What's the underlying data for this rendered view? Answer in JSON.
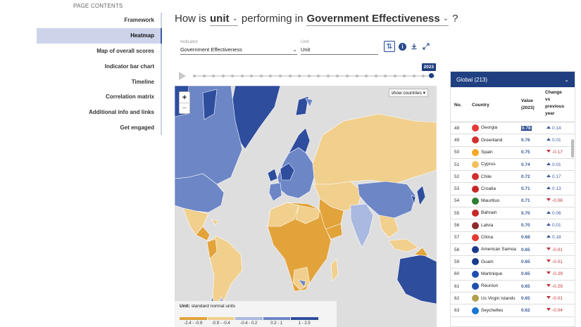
{
  "nav": {
    "heading": "PAGE CONTENTS",
    "items": [
      {
        "label": "Framework",
        "active": false
      },
      {
        "label": "Heatmap",
        "active": true
      },
      {
        "label": "Map of overall scores",
        "active": false
      },
      {
        "label": "Indicator bar chart",
        "active": false
      },
      {
        "label": "Timeline",
        "active": false
      },
      {
        "label": "Correlation matrix",
        "active": false
      },
      {
        "label": "Additional info and links",
        "active": false
      },
      {
        "label": "Get engaged",
        "active": false
      }
    ]
  },
  "question": {
    "prefix": "How is",
    "unit_select": "unit",
    "middle": "performing in",
    "indicator_select": "Government Effectiveness",
    "suffix": "?"
  },
  "filters": {
    "indicator_label": "Indicator",
    "indicator_value": "Government Effectiveness",
    "unit_label": "Unit",
    "unit_value": "Unit"
  },
  "toolbar": {
    "settings_icon": "sliders-icon",
    "info_icon": "info-icon",
    "download_icon": "download-icon",
    "expand_icon": "expand-icon"
  },
  "timeline": {
    "year": "2023"
  },
  "map": {
    "zoom_in": "+",
    "zoom_out": "−",
    "show_countries": "show countries",
    "legend_title": "Unit:",
    "legend_unit": "standard normal units",
    "legend_bins": [
      {
        "label": "-2.4 - -0.9",
        "color": "#e2a33b"
      },
      {
        "label": "-0.9 - -0.4",
        "color": "#f1cf8d"
      },
      {
        "label": "-0.4 - 0.2",
        "color": "#a9b9df"
      },
      {
        "label": "0.2 - 1",
        "color": "#6c86c6"
      },
      {
        "label": "1 - 2.5",
        "color": "#2e4d9d"
      }
    ]
  },
  "panel": {
    "title": "Global (213)",
    "col_no": "No.",
    "col_country": "Country",
    "col_value_1": "Value",
    "col_value_2": "(2023)",
    "col_change_1": "Change",
    "col_change_2": "vs",
    "col_change_3": "previous",
    "col_change_4": "year",
    "rows": [
      {
        "no": "48",
        "country": "Georgia",
        "value": "0.78",
        "change": "0.14",
        "dir": "up",
        "highlight": true,
        "flag": "#e53935"
      },
      {
        "no": "49",
        "country": "Greenland",
        "value": "0.76",
        "change": "0.01",
        "dir": "up",
        "highlight": false,
        "flag": "#d32f2f"
      },
      {
        "no": "50",
        "country": "Spain",
        "value": "0.75",
        "change": "-0.17",
        "dir": "down",
        "highlight": false,
        "flag": "#f9a825"
      },
      {
        "no": "51",
        "country": "Cyprus",
        "value": "0.74",
        "change": "0.01",
        "dir": "up",
        "highlight": false,
        "flag": "#f0c060"
      },
      {
        "no": "52",
        "country": "Chile",
        "value": "0.72",
        "change": "0.17",
        "dir": "up",
        "highlight": false,
        "flag": "#d32f2f"
      },
      {
        "no": "53",
        "country": "Croatia",
        "value": "0.71",
        "change": "0.13",
        "dir": "up",
        "highlight": false,
        "flag": "#c62828"
      },
      {
        "no": "54",
        "country": "Mauritius",
        "value": "0.71",
        "change": "-0.06",
        "dir": "down",
        "highlight": false,
        "flag": "#2e7d32"
      },
      {
        "no": "55",
        "country": "Bahrain",
        "value": "0.70",
        "change": "0.06",
        "dir": "up",
        "highlight": false,
        "flag": "#c62828"
      },
      {
        "no": "56",
        "country": "Latvia",
        "value": "0.70",
        "change": "0.01",
        "dir": "up",
        "highlight": false,
        "flag": "#8e2a2a"
      },
      {
        "no": "57",
        "country": "China",
        "value": "0.68",
        "change": "0.18",
        "dir": "up",
        "highlight": false,
        "flag": "#e53935"
      },
      {
        "no": "58",
        "country": "American Samoa",
        "value": "0.65",
        "change": "-0.01",
        "dir": "down",
        "highlight": false,
        "flag": "#1a3a8a"
      },
      {
        "no": "59",
        "country": "Guam",
        "value": "0.65",
        "change": "-0.01",
        "dir": "down",
        "highlight": false,
        "flag": "#1a3a8a"
      },
      {
        "no": "60",
        "country": "Martinique",
        "value": "0.65",
        "change": "-0.29",
        "dir": "down",
        "highlight": false,
        "flag": "#1e4fb0"
      },
      {
        "no": "61",
        "country": "Réunion",
        "value": "0.65",
        "change": "-0.29",
        "dir": "down",
        "highlight": false,
        "flag": "#1e4fb0"
      },
      {
        "no": "62",
        "country": "Us Virgin Islands",
        "value": "0.65",
        "change": "-0.01",
        "dir": "down",
        "highlight": false,
        "flag": "#b0a050"
      },
      {
        "no": "63",
        "country": "Seychelles",
        "value": "0.62",
        "change": "-0.04",
        "dir": "down",
        "highlight": false,
        "flag": "#1976d2"
      }
    ]
  }
}
